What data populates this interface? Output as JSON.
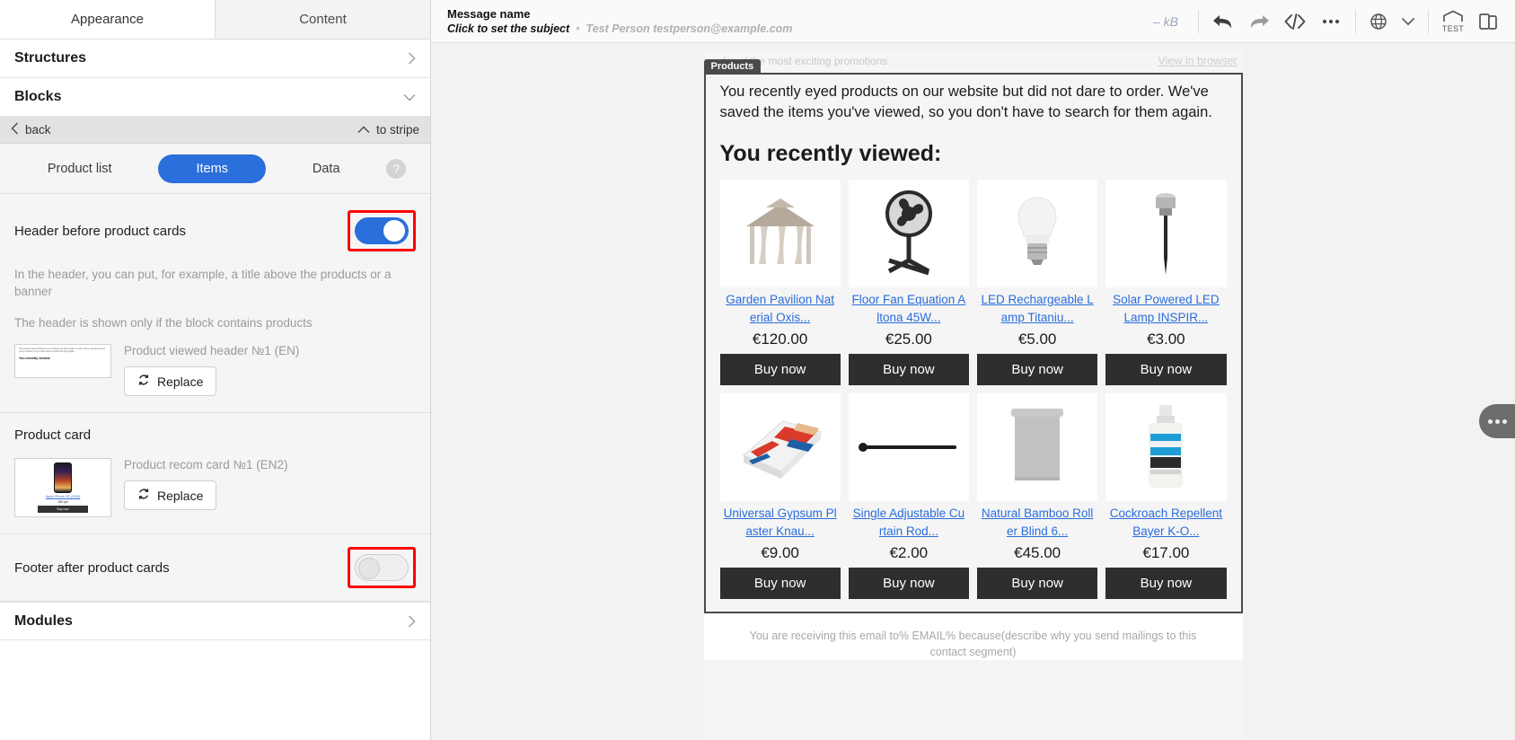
{
  "sidebar": {
    "tabs": [
      {
        "label": "Appearance",
        "active": true
      },
      {
        "label": "Content",
        "active": false
      }
    ],
    "sections": [
      {
        "label": "Structures",
        "chevron": "›"
      },
      {
        "label": "Blocks",
        "chevron": "⌄"
      }
    ],
    "backbar": {
      "back_label": "back",
      "to_stripe_label": "to stripe",
      "back_icon": "chevron-left-icon",
      "up_icon": "chevron-up-icon"
    },
    "segments": [
      {
        "label": "Product list",
        "active": false
      },
      {
        "label": "Items",
        "active": true
      },
      {
        "label": "Data",
        "active": false
      }
    ],
    "help_icon": "question-mark-icon",
    "header_option": {
      "label": "Header before product cards",
      "toggle_state": "on",
      "hint": "In the header, you can put, for example, a title above the products or a banner",
      "hint2": "The header is shown only if the block contains products",
      "asset_name": "Product viewed header №1 (EN)",
      "replace_label": "Replace",
      "replace_icon": "refresh-icon",
      "thumb_text": "You recently eyed products on our website but did not dare to order. We've saved the items you've viewed, so you don't have to search for them again.",
      "thumb_title": "You recently viewed:"
    },
    "product_card_option": {
      "label": "Product card",
      "asset_name": "Product recom card №1 (EN2)",
      "replace_label": "Replace",
      "replace_icon": "refresh-icon",
      "thumb_link": "Apple iPhone SE (2020)",
      "thumb_price": "180 грн",
      "thumb_button": "Buy now"
    },
    "footer_option": {
      "label": "Footer after product cards",
      "toggle_state": "off"
    },
    "modules_section": {
      "label": "Modules",
      "chevron": "›"
    }
  },
  "topbar": {
    "message_name": "Message name",
    "subject_placeholder": "Click to set the subject",
    "separator": "•",
    "recipient": "Test Person testperson@example.com",
    "size_label": "– kB",
    "tools": [
      {
        "name": "undo-icon"
      },
      {
        "name": "redo-icon"
      },
      {
        "name": "code-icon"
      },
      {
        "name": "more-horizontal-icon"
      },
      {
        "name": "globe-icon"
      },
      {
        "name": "chevron-down-icon"
      },
      {
        "name": "test-email-icon",
        "label": "TEST"
      },
      {
        "name": "preview-panel-icon"
      }
    ]
  },
  "email": {
    "preheader_text": "…der of the most exciting promotions",
    "view_in_browser": "View in browser",
    "block_tag": "Products",
    "intro": "You recently eyed products on our website but did not dare to order. We've saved the items you've viewed, so you don't have to search for them again.",
    "headline": "You recently viewed:",
    "buy_label": "Buy now",
    "products": [
      {
        "name": "Garden Pavilion Nat erial Oxis...",
        "price": "€120.00",
        "image": "garden-pavilion-image"
      },
      {
        "name": "Floor Fan Equation A ltona 45W...",
        "price": "€25.00",
        "image": "floor-fan-image"
      },
      {
        "name": "LED Rechargeable L amp Titaniu...",
        "price": "€5.00",
        "image": "led-bulb-image"
      },
      {
        "name": "Solar Powered LED Lamp INSPIR...",
        "price": "€3.00",
        "image": "solar-lamp-image"
      },
      {
        "name": "Universal Gypsum Pl aster Knau...",
        "price": "€9.00",
        "image": "gypsum-bag-image"
      },
      {
        "name": "Single Adjustable Cu rtain Rod...",
        "price": "€2.00",
        "image": "curtain-rod-image"
      },
      {
        "name": "Natural Bamboo Roll er Blind 6...",
        "price": "€45.00",
        "image": "roller-blind-image"
      },
      {
        "name": "Cockroach Repellent Bayer K-O...",
        "price": "€17.00",
        "image": "repellent-bottle-image"
      }
    ],
    "footer_note": "You are receiving this email to% EMAIL% because(describe why you send mailings to this contact segment)"
  },
  "colors": {
    "accent": "#2a6fdb",
    "highlight_border": "#ff0000",
    "buy_button": "#2e2e2e",
    "link": "#2a6ddb"
  }
}
